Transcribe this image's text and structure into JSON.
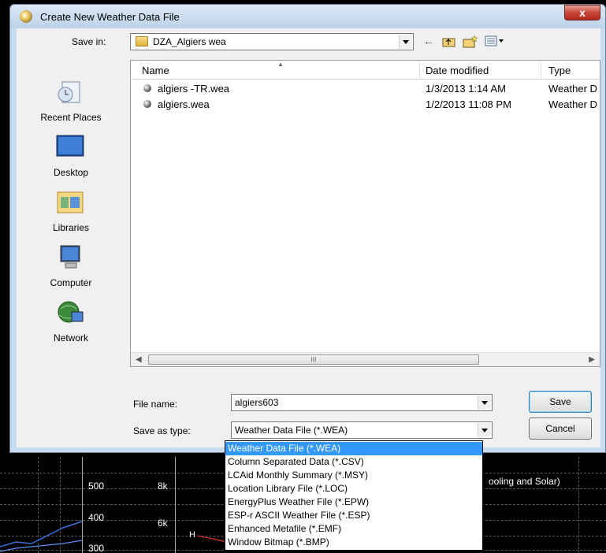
{
  "dialog": {
    "title": "Create New Weather Data File",
    "close_label": "x"
  },
  "save_in": {
    "label": "Save in:",
    "value": "DZA_Algiers wea"
  },
  "places": [
    {
      "label": "Recent Places",
      "icon": "recent-places-icon"
    },
    {
      "label": "Desktop",
      "icon": "desktop-icon"
    },
    {
      "label": "Libraries",
      "icon": "libraries-icon"
    },
    {
      "label": "Computer",
      "icon": "computer-icon"
    },
    {
      "label": "Network",
      "icon": "network-icon"
    }
  ],
  "file_list": {
    "columns": [
      "Name",
      "Date modified",
      "Type"
    ],
    "rows": [
      {
        "name": "algiers -TR.wea",
        "date": "1/3/2013 1:14 AM",
        "type": "Weather D"
      },
      {
        "name": "algiers.wea",
        "date": "1/2/2013 11:08 PM",
        "type": "Weather D"
      }
    ],
    "scroll_thumb_label": "III"
  },
  "file_name": {
    "label": "File name:",
    "value": "algiers603"
  },
  "save_as_type": {
    "label": "Save as type:",
    "value": "Weather Data File (*.WEA)",
    "options": [
      "Weather Data File (*.WEA)",
      "Column Separated Data (*.CSV)",
      "LCAid Monthly Summary (*.MSY)",
      "Location Library File (*.LOC)",
      "EnergyPlus Weather File (*.EPW)",
      "ESP-r ASCII Weather File (*.ESP)",
      "Enhanced Metafile (*.EMF)",
      "Window Bitmap (*.BMP)"
    ],
    "selected_index": 0
  },
  "buttons": {
    "save": "Save",
    "cancel": "Cancel"
  },
  "background_chart": {
    "left_ticks": [
      "500",
      "400",
      "300"
    ],
    "right_ticks": [
      "8k",
      "6k"
    ],
    "title_fragment": "ooling and Solar)",
    "marker": "H"
  }
}
